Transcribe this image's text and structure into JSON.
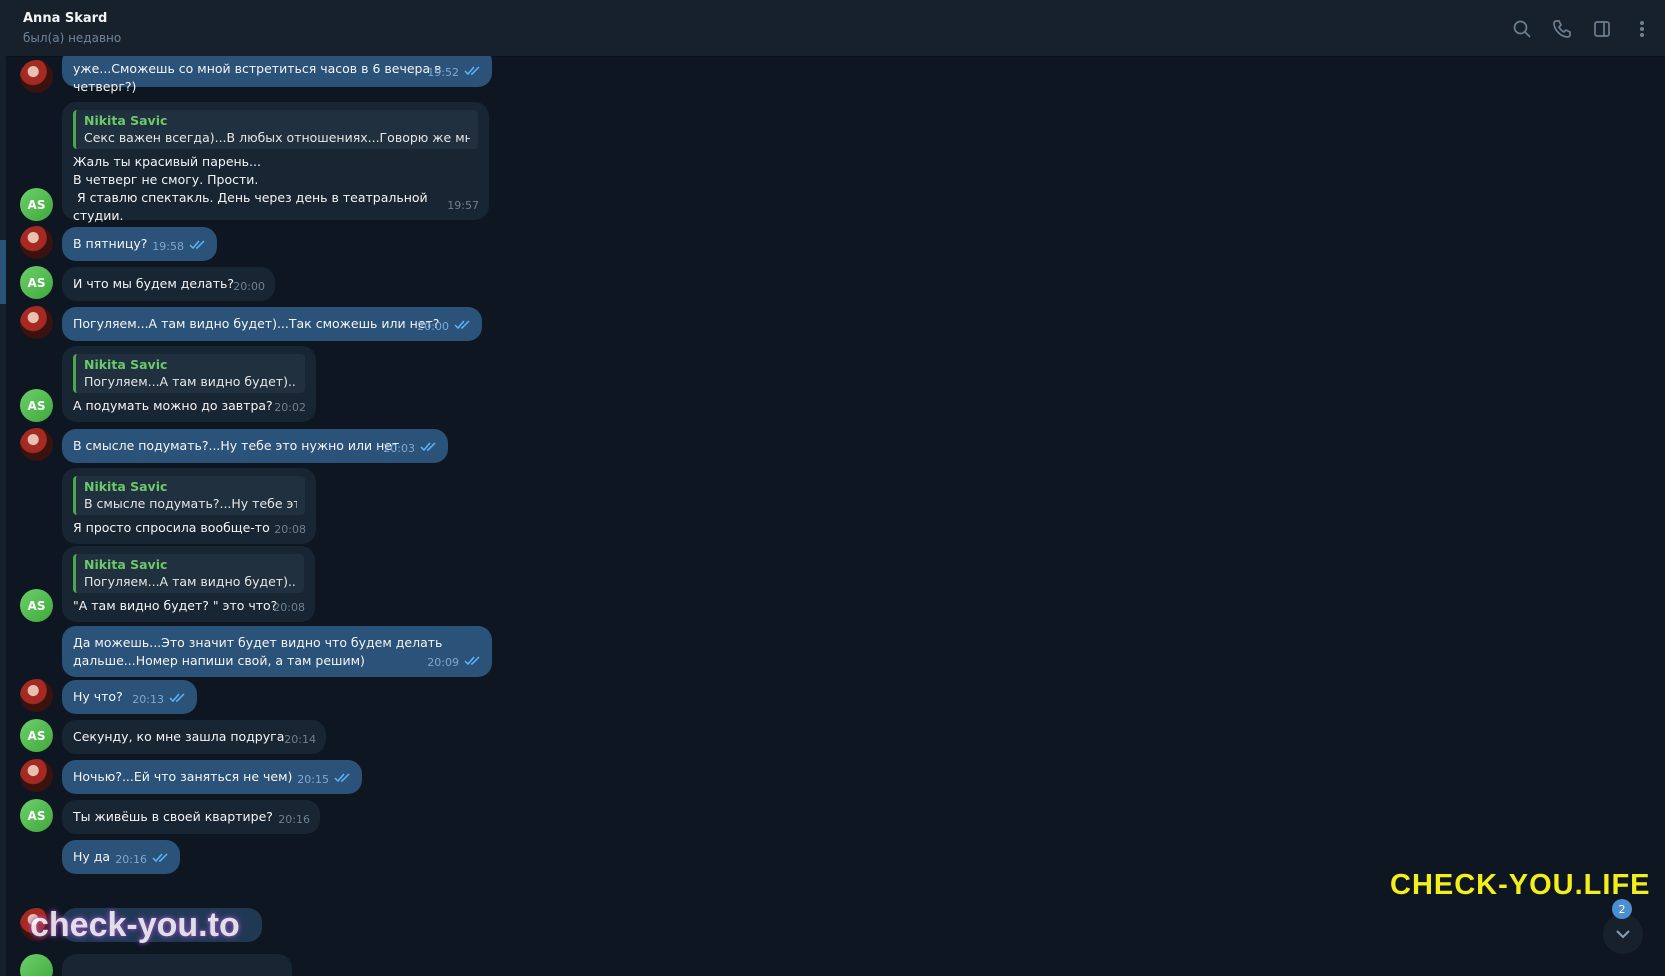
{
  "header": {
    "name": "Anna Skard",
    "status": "был(а) недавно",
    "icons": [
      "search-icon",
      "phone-icon",
      "sidebar-toggle-icon",
      "more-vertical-icon"
    ]
  },
  "messages": [
    {
      "from": "Nikita Savic",
      "dir": "out",
      "text": "уже...Сможешь со мной встретиться часов в 6 вечера в четверг?)",
      "time": "19:52",
      "read": true
    },
    {
      "from": "Anna Skard",
      "dir": "in",
      "avatar": "AS",
      "reply": {
        "name": "Nikita Savic",
        "text": "Секс важен всегда)...В любых отношениях...Говорю же мног..."
      },
      "text": "Жаль ты красивый парень...\nВ четверг не смогу. Прости.\n Я ставлю спектакль. День через день в театральной студии.",
      "time": "19:57"
    },
    {
      "from": "Nikita Savic",
      "dir": "out",
      "text": "В пятницу?",
      "time": "19:58",
      "read": true
    },
    {
      "from": "Anna Skard",
      "dir": "in",
      "avatar": "AS",
      "text": "И что мы будем делать?",
      "time": "20:00"
    },
    {
      "from": "Nikita Savic",
      "dir": "out",
      "text": "Погуляем...А там видно будет)...Так сможешь или нет?",
      "time": "20:00",
      "read": true
    },
    {
      "from": "Anna Skard",
      "dir": "in",
      "avatar": "AS",
      "reply": {
        "name": "Nikita Savic",
        "text": "Погуляем...А там видно будет)......"
      },
      "text": "А подумать можно до завтра?",
      "time": "20:02"
    },
    {
      "from": "Nikita Savic",
      "dir": "out",
      "text": "В смысле подумать?...Ну тебе это нужно или нет",
      "time": "20:03",
      "read": true
    },
    {
      "from": "Anna Skard",
      "dir": "in",
      "reply": {
        "name": "Nikita Savic",
        "text": "В смысле подумать?...Ну тебе эт..."
      },
      "text": "Я просто спросила вообще-то",
      "time": "20:08"
    },
    {
      "from": "Anna Skard",
      "dir": "in",
      "avatar": "AS",
      "reply": {
        "name": "Nikita Savic",
        "text": "Погуляем...А там видно будет)......"
      },
      "text": "\"А там видно будет? \" это что?",
      "time": "20:08"
    },
    {
      "from": "Nikita Savic",
      "dir": "out",
      "text": "Да можешь...Это значит будет видно что будем делать\nдальше...Номер напиши свой, а там решим)",
      "time": "20:09",
      "read": true
    },
    {
      "from": "Nikita Savic",
      "dir": "out",
      "text": "Ну что?",
      "time": "20:13",
      "read": true
    },
    {
      "from": "Anna Skard",
      "dir": "in",
      "avatar": "AS",
      "text": "Секунду, ко мне зашла подруга",
      "time": "20:14"
    },
    {
      "from": "Nikita Savic",
      "dir": "out",
      "text": "Ночью?...Ей что заняться не чем)",
      "time": "20:15",
      "read": true
    },
    {
      "from": "Anna Skard",
      "dir": "in",
      "avatar": "AS",
      "text": "Ты живёшь в своей квартире?",
      "time": "20:16"
    },
    {
      "from": "Nikita Savic",
      "dir": "out",
      "text": "Ну да",
      "time": "20:16",
      "read": true
    }
  ],
  "watermarks": {
    "right": "CHECK-YOU.LIFE",
    "left": "check-you.to"
  },
  "scroll_down": {
    "unread_count": "2"
  }
}
